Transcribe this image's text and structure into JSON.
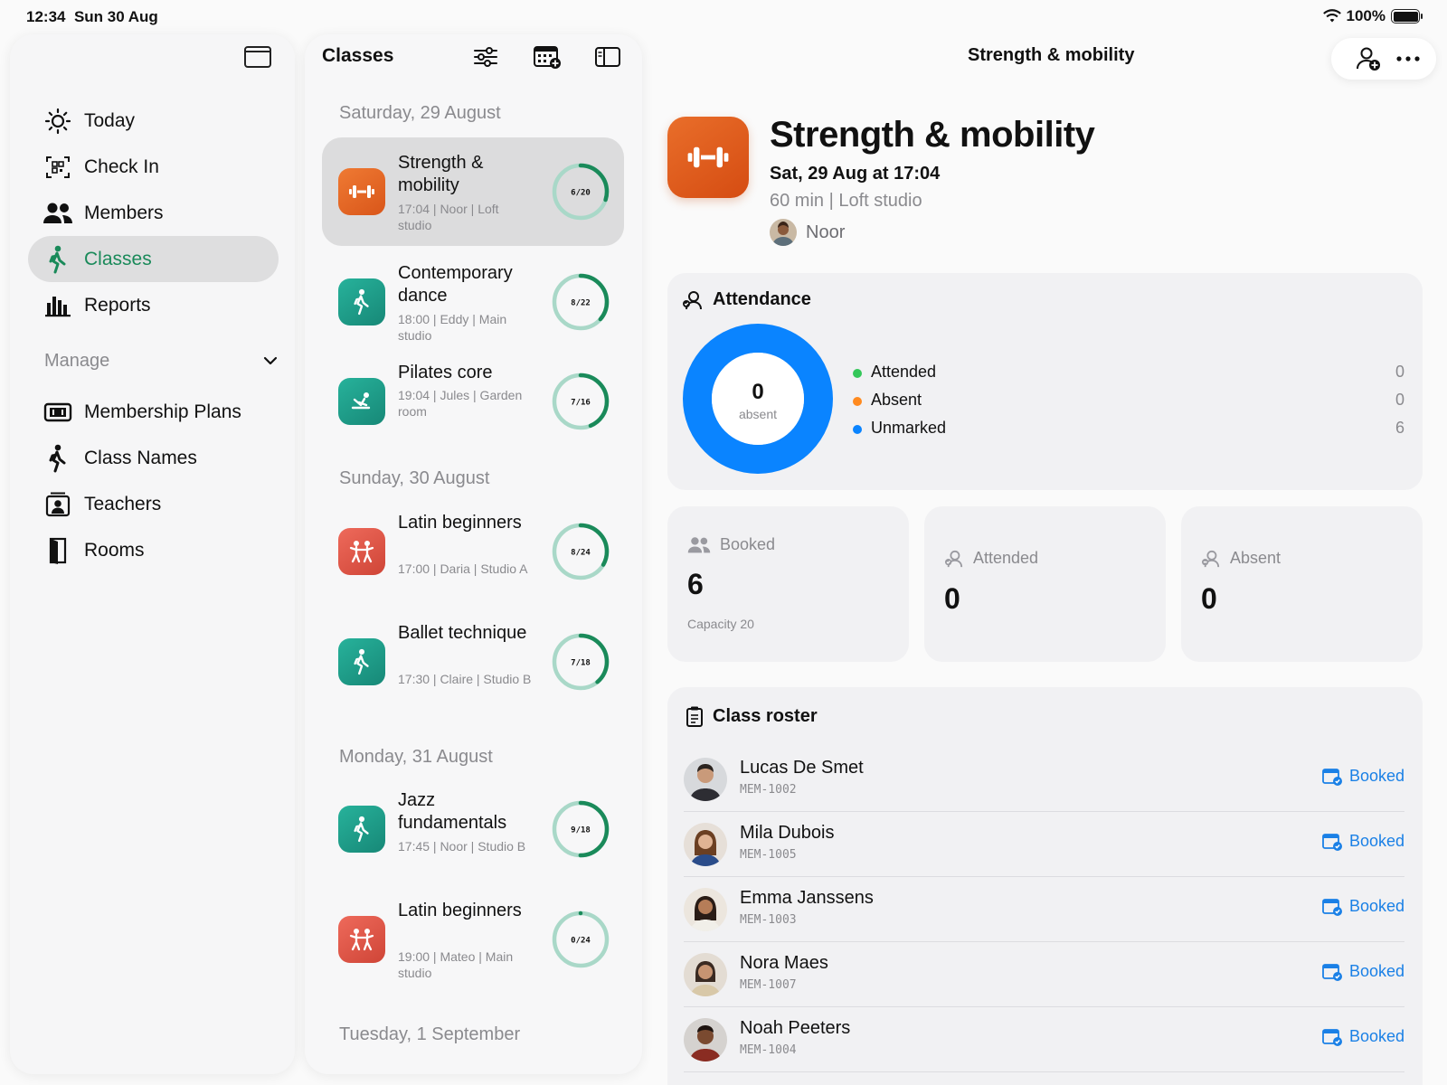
{
  "status_bar": {
    "time": "12:34",
    "date": "Sun 30 Aug",
    "battery": "100%"
  },
  "sidebar": {
    "items": [
      {
        "label": "Today",
        "icon": "sun-icon"
      },
      {
        "label": "Check In",
        "icon": "qr-scan-icon"
      },
      {
        "label": "Members",
        "icon": "people-icon"
      },
      {
        "label": "Classes",
        "icon": "figure-walk-icon",
        "active": true
      },
      {
        "label": "Reports",
        "icon": "bar-chart-icon"
      }
    ],
    "manage_label": "Manage",
    "manage_items": [
      {
        "label": "Membership Plans",
        "icon": "ticket-icon"
      },
      {
        "label": "Class Names",
        "icon": "figure-walk-icon"
      },
      {
        "label": "Teachers",
        "icon": "teacher-icon"
      },
      {
        "label": "Rooms",
        "icon": "door-icon"
      }
    ]
  },
  "class_list": {
    "title": "Classes",
    "days": [
      "Saturday, 29 August",
      "Sunday, 30 August",
      "Monday, 31 August",
      "Tuesday, 1 September"
    ],
    "classes": [
      {
        "name": "Strength & mobility",
        "meta": "17:04 | Noor | Loft studio",
        "booked": 6,
        "capacity": 20,
        "label": "6/20",
        "color": "#e0601f",
        "selected": true
      },
      {
        "name": "Contemporary dance",
        "meta": "18:00 | Eddy | Main studio",
        "booked": 8,
        "capacity": 22,
        "label": "8/22",
        "color": "#1e9e8a"
      },
      {
        "name": "Pilates core",
        "meta": "19:04 | Jules | Garden room",
        "booked": 7,
        "capacity": 16,
        "label": "7/16",
        "color": "#1e9e8a"
      },
      {
        "name": "Latin beginners",
        "meta": "17:00 | Daria | Studio A",
        "booked": 8,
        "capacity": 24,
        "label": "8/24",
        "color": "#e0584a"
      },
      {
        "name": "Ballet technique",
        "meta": "17:30 | Claire | Studio B",
        "booked": 7,
        "capacity": 18,
        "label": "7/18",
        "color": "#1e9e8a"
      },
      {
        "name": "Jazz fundamentals",
        "meta": "17:45 | Noor | Studio B",
        "booked": 9,
        "capacity": 18,
        "label": "9/18",
        "color": "#1e9e8a"
      },
      {
        "name": "Latin beginners",
        "meta": "19:00 | Mateo | Main studio",
        "booked": 0,
        "capacity": 24,
        "label": "0/24",
        "color": "#e0584a"
      }
    ]
  },
  "detail": {
    "nav_title": "Strength & mobility",
    "name": "Strength & mobility",
    "date": "Sat, 29 Aug at 17:04",
    "meta": "60 min | Loft studio",
    "teacher": "Noor",
    "attendance": {
      "title": "Attendance",
      "center_value": "0",
      "center_label": "absent",
      "legend": [
        {
          "label": "Attended",
          "value": "0",
          "color": "#34c759"
        },
        {
          "label": "Absent",
          "value": "0",
          "color": "#ff8a1f"
        },
        {
          "label": "Unmarked",
          "value": "6",
          "color": "#0a84ff"
        }
      ]
    },
    "stats": [
      {
        "label": "Booked",
        "value": "6",
        "sub": "Capacity 20"
      },
      {
        "label": "Attended",
        "value": "0"
      },
      {
        "label": "Absent",
        "value": "0"
      }
    ],
    "roster": {
      "title": "Class roster",
      "members": [
        {
          "name": "Lucas De Smet",
          "id": "MEM-1002",
          "status": "Booked"
        },
        {
          "name": "Mila Dubois",
          "id": "MEM-1005",
          "status": "Booked"
        },
        {
          "name": "Emma Janssens",
          "id": "MEM-1003",
          "status": "Booked"
        },
        {
          "name": "Nora Maes",
          "id": "MEM-1007",
          "status": "Booked"
        },
        {
          "name": "Noah Peeters",
          "id": "MEM-1004",
          "status": "Booked"
        }
      ]
    }
  },
  "colors": {
    "accent_green": "#1a8a5a",
    "link_blue": "#1a80e6",
    "donut_blue": "#0a84ff"
  }
}
